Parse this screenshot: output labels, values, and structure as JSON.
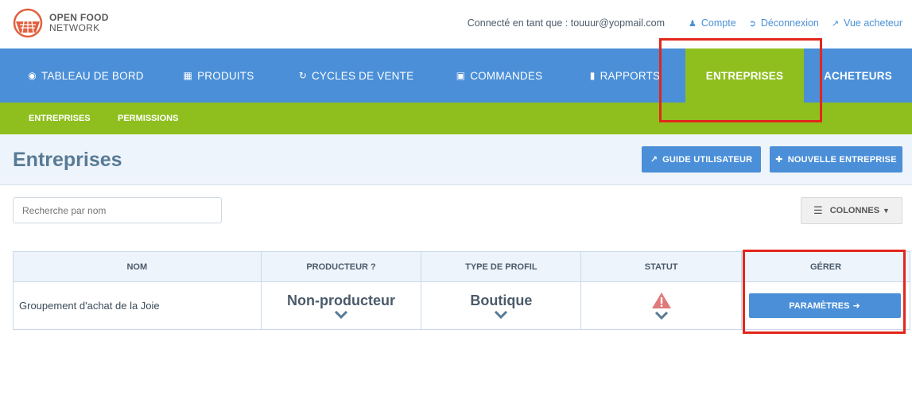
{
  "logo": {
    "line1": "OPEN FOOD",
    "line2": "NETWORK"
  },
  "userbar": {
    "signed_in": "Connecté en tant que : touuur@yopmail.com",
    "account": "Compte",
    "logout": "Déconnexion",
    "storefront": "Vue acheteur"
  },
  "nav": {
    "items": [
      {
        "label": "TABLEAU DE BORD",
        "icon": "dashboard-icon"
      },
      {
        "label": "PRODUITS",
        "icon": "grid-icon"
      },
      {
        "label": "CYCLES DE VENTE",
        "icon": "refresh-icon"
      },
      {
        "label": "COMMANDES",
        "icon": "cart-icon"
      },
      {
        "label": "RAPPORTS",
        "icon": "file-icon"
      },
      {
        "label": "ENTREPRISES",
        "icon": ""
      },
      {
        "label": "ACHETEURS",
        "icon": ""
      }
    ],
    "active": "ENTREPRISES"
  },
  "subnav": {
    "items": [
      "ENTREPRISES",
      "PERMISSIONS"
    ]
  },
  "page": {
    "title": "Entreprises",
    "guide_button": "GUIDE UTILISATEUR",
    "new_button": "NOUVELLE ENTREPRISE"
  },
  "search": {
    "placeholder": "Recherche par nom"
  },
  "columns_button": "COLONNES",
  "table": {
    "headers": [
      "NOM",
      "PRODUCTEUR ?",
      "TYPE DE PROFIL",
      "STATUT",
      "GÉRER"
    ],
    "rows": [
      {
        "name": "Groupement d'achat de la Joie",
        "producer": "Non-producteur",
        "profile": "Boutique",
        "status": "warning-icon",
        "manage": "PARAMÈTRES"
      }
    ]
  },
  "colors": {
    "nav_blue": "#4a8fd8",
    "accent_green": "#8fbf1f",
    "highlight_red": "#e3261b"
  }
}
